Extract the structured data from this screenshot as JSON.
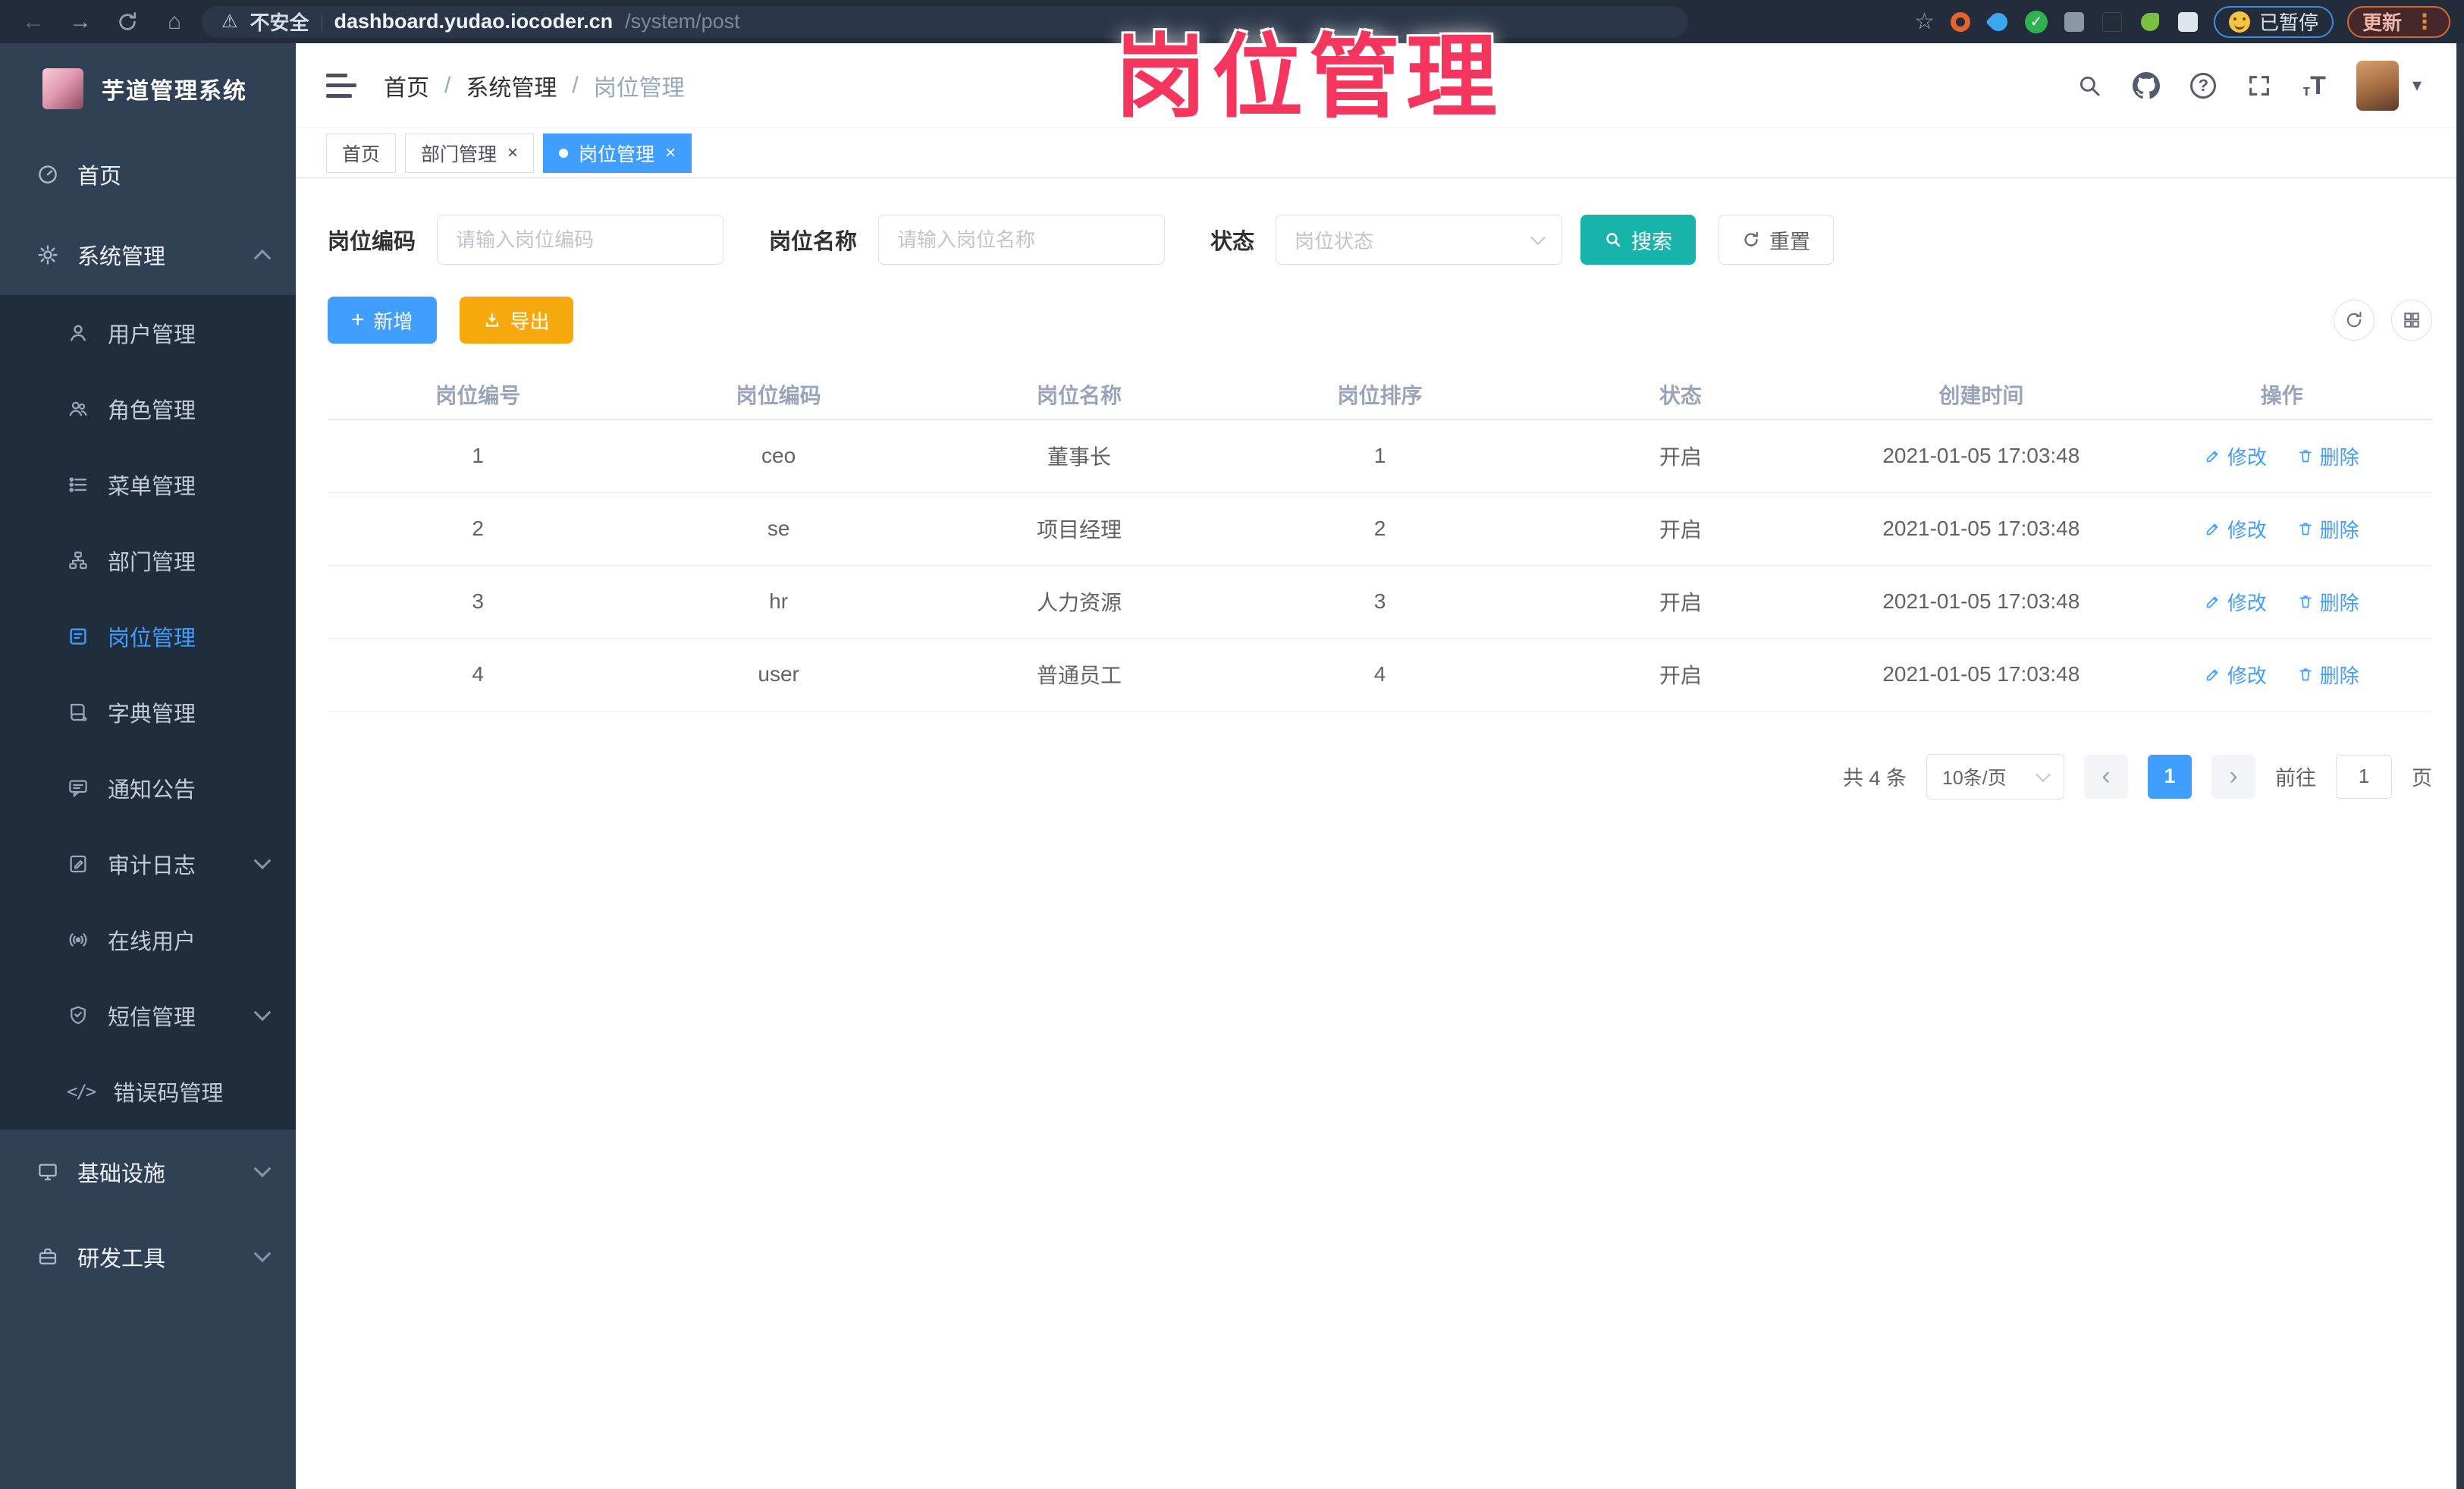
{
  "watermark": {
    "text": "岗位管理"
  },
  "browser": {
    "security_label": "不安全",
    "url_host": "dashboard.yudao.iocoder.cn",
    "url_path": "/system/post",
    "paused_badge": "已暂停",
    "update_button": "更新"
  },
  "icons": {
    "back": "←",
    "forward": "→",
    "home": "⌂",
    "warning": "⚠",
    "star": "☆",
    "menu_dots": "⋮",
    "close": "×",
    "prev": "‹",
    "next": "›",
    "plus": "+",
    "check": "✓",
    "question": "?",
    "code": "</>",
    "caret": "▾",
    "t_small": "т",
    "t_big": "T"
  },
  "sidebar": {
    "logo_title": "芋道管理系统",
    "top_items": [
      {
        "label": "首页"
      },
      {
        "label": "系统管理"
      }
    ],
    "sub_items": [
      {
        "label": "用户管理"
      },
      {
        "label": "角色管理"
      },
      {
        "label": "菜单管理"
      },
      {
        "label": "部门管理"
      },
      {
        "label": "岗位管理"
      },
      {
        "label": "字典管理"
      },
      {
        "label": "通知公告"
      },
      {
        "label": "审计日志"
      },
      {
        "label": "在线用户"
      },
      {
        "label": "短信管理"
      },
      {
        "label": "错误码管理"
      }
    ],
    "bottom_items": [
      {
        "label": "基础设施"
      },
      {
        "label": "研发工具"
      }
    ]
  },
  "header": {
    "breadcrumb": [
      "首页",
      "系统管理",
      "岗位管理"
    ],
    "breadcrumb_separator": "/"
  },
  "tabs": [
    {
      "label": "首页"
    },
    {
      "label": "部门管理"
    },
    {
      "label": "岗位管理"
    }
  ],
  "filters": {
    "fields": [
      {
        "label": "岗位编码",
        "placeholder": "请输入岗位编码"
      },
      {
        "label": "岗位名称",
        "placeholder": "请输入岗位名称"
      },
      {
        "label": "状态",
        "placeholder": "岗位状态"
      }
    ],
    "search_label": "搜索",
    "reset_label": "重置"
  },
  "toolbar": {
    "add_label": "新增",
    "export_label": "导出"
  },
  "table": {
    "columns": [
      "岗位编号",
      "岗位编码",
      "岗位名称",
      "岗位排序",
      "状态",
      "创建时间",
      "操作"
    ],
    "actions": {
      "edit": "修改",
      "delete": "删除"
    },
    "rows": [
      {
        "id": "1",
        "code": "ceo",
        "name": "董事长",
        "sort": "1",
        "status": "开启",
        "created": "2021-01-05 17:03:48"
      },
      {
        "id": "2",
        "code": "se",
        "name": "项目经理",
        "sort": "2",
        "status": "开启",
        "created": "2021-01-05 17:03:48"
      },
      {
        "id": "3",
        "code": "hr",
        "name": "人力资源",
        "sort": "3",
        "status": "开启",
        "created": "2021-01-05 17:03:48"
      },
      {
        "id": "4",
        "code": "user",
        "name": "普通员工",
        "sort": "4",
        "status": "开启",
        "created": "2021-01-05 17:03:48"
      }
    ]
  },
  "pagination": {
    "total_text": "共 4 条",
    "page_size": "10条/页",
    "current_page": "1",
    "goto_prefix": "前往",
    "goto_suffix": "页",
    "goto_value": "1"
  },
  "colors": {
    "accent": "#409eff",
    "search_teal": "#18b3aa",
    "export_orange": "#f6a90d",
    "watermark_pink": "#f4365e",
    "sidebar_bg": "#304156",
    "submenu_bg": "#1f2d3d"
  }
}
